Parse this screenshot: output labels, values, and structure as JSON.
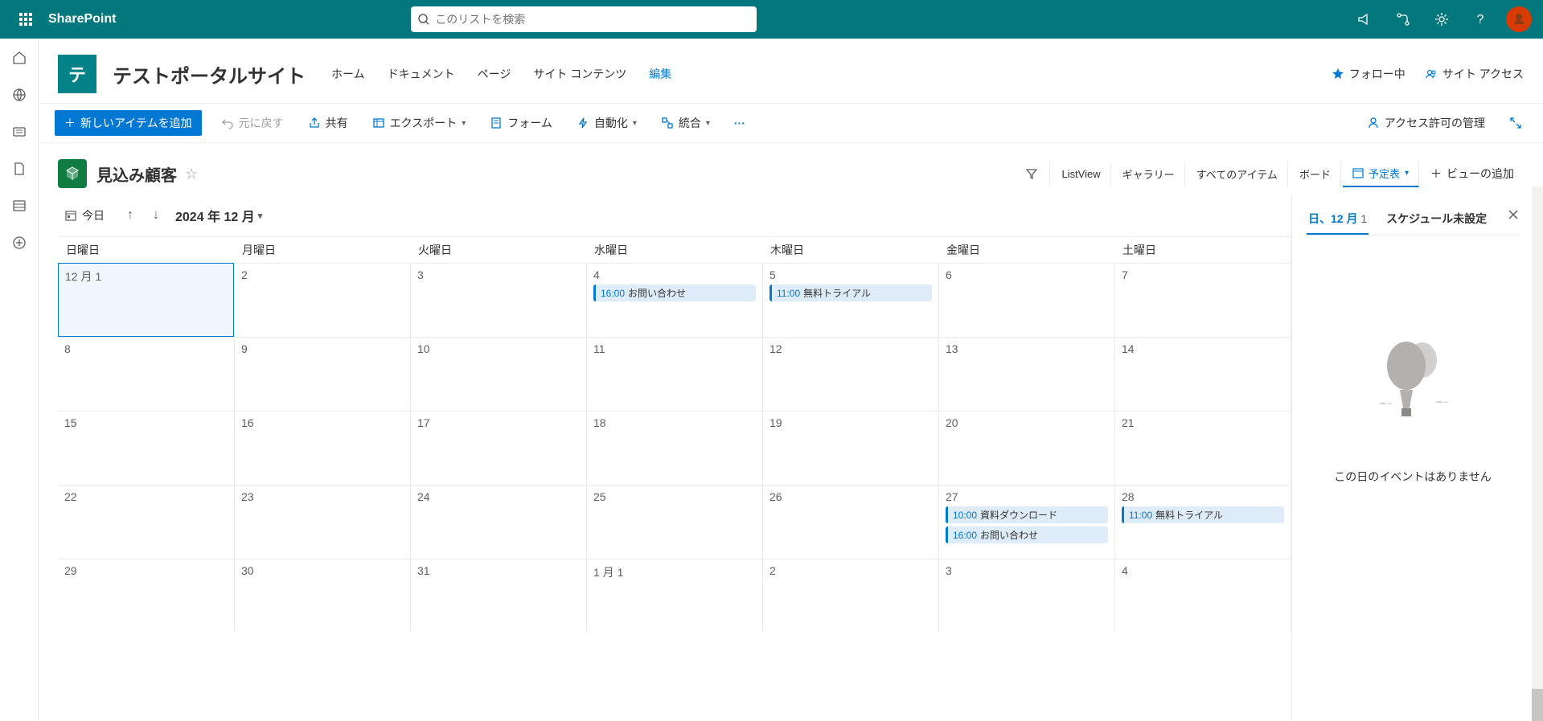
{
  "suite": {
    "brand": "SharePoint",
    "search_placeholder": "このリストを検索"
  },
  "site": {
    "logo_letter": "テ",
    "name": "テストポータルサイト",
    "nav": {
      "home": "ホーム",
      "documents": "ドキュメント",
      "pages": "ページ",
      "contents": "サイト コンテンツ",
      "edit": "編集"
    },
    "follow": "フォロー中",
    "access": "サイト アクセス"
  },
  "cmd": {
    "new_item": "新しいアイテムを追加",
    "undo": "元に戻す",
    "share": "共有",
    "export": "エクスポート",
    "form": "フォーム",
    "automate": "自動化",
    "integrate": "統合",
    "permissions": "アクセス許可の管理"
  },
  "list": {
    "title": "見込み顧客",
    "views": {
      "listview": "ListView",
      "gallery": "ギャラリー",
      "all_items": "すべてのアイテム",
      "board": "ボード",
      "calendar": "予定表",
      "add_view": "ビューの追加"
    }
  },
  "calendar": {
    "today": "今日",
    "month_label": "2024 年 12 月",
    "days": {
      "sun": "日曜日",
      "mon": "月曜日",
      "tue": "火曜日",
      "wed": "水曜日",
      "thu": "木曜日",
      "fri": "金曜日",
      "sat": "土曜日"
    },
    "cells": [
      {
        "label": "12 月 1",
        "selected": true,
        "events": []
      },
      {
        "label": "2",
        "events": []
      },
      {
        "label": "3",
        "events": []
      },
      {
        "label": "4",
        "events": [
          {
            "time": "16:00",
            "title": "お問い合わせ"
          }
        ]
      },
      {
        "label": "5",
        "events": [
          {
            "time": "11:00",
            "title": "無料トライアル"
          }
        ]
      },
      {
        "label": "6",
        "events": []
      },
      {
        "label": "7",
        "events": []
      },
      {
        "label": "8",
        "events": []
      },
      {
        "label": "9",
        "events": []
      },
      {
        "label": "10",
        "events": []
      },
      {
        "label": "11",
        "events": []
      },
      {
        "label": "12",
        "events": []
      },
      {
        "label": "13",
        "events": []
      },
      {
        "label": "14",
        "events": []
      },
      {
        "label": "15",
        "events": []
      },
      {
        "label": "16",
        "events": []
      },
      {
        "label": "17",
        "events": []
      },
      {
        "label": "18",
        "events": []
      },
      {
        "label": "19",
        "events": []
      },
      {
        "label": "20",
        "events": []
      },
      {
        "label": "21",
        "events": []
      },
      {
        "label": "22",
        "events": []
      },
      {
        "label": "23",
        "events": []
      },
      {
        "label": "24",
        "events": []
      },
      {
        "label": "25",
        "events": []
      },
      {
        "label": "26",
        "events": []
      },
      {
        "label": "27",
        "events": [
          {
            "time": "10:00",
            "title": "資料ダウンロード"
          },
          {
            "time": "16:00",
            "title": "お問い合わせ"
          }
        ]
      },
      {
        "label": "28",
        "events": [
          {
            "time": "11:00",
            "title": "無料トライアル"
          }
        ]
      },
      {
        "label": "29",
        "events": []
      },
      {
        "label": "30",
        "events": []
      },
      {
        "label": "31",
        "events": []
      },
      {
        "label": "1 月 1",
        "events": []
      },
      {
        "label": "2",
        "events": []
      },
      {
        "label": "3",
        "events": []
      },
      {
        "label": "4",
        "events": []
      }
    ]
  },
  "panel": {
    "tab_date_prefix": "日、12 月 ",
    "tab_date_num": "1",
    "tab_unscheduled": "スケジュール未設定",
    "empty": "この日のイベントはありません"
  }
}
